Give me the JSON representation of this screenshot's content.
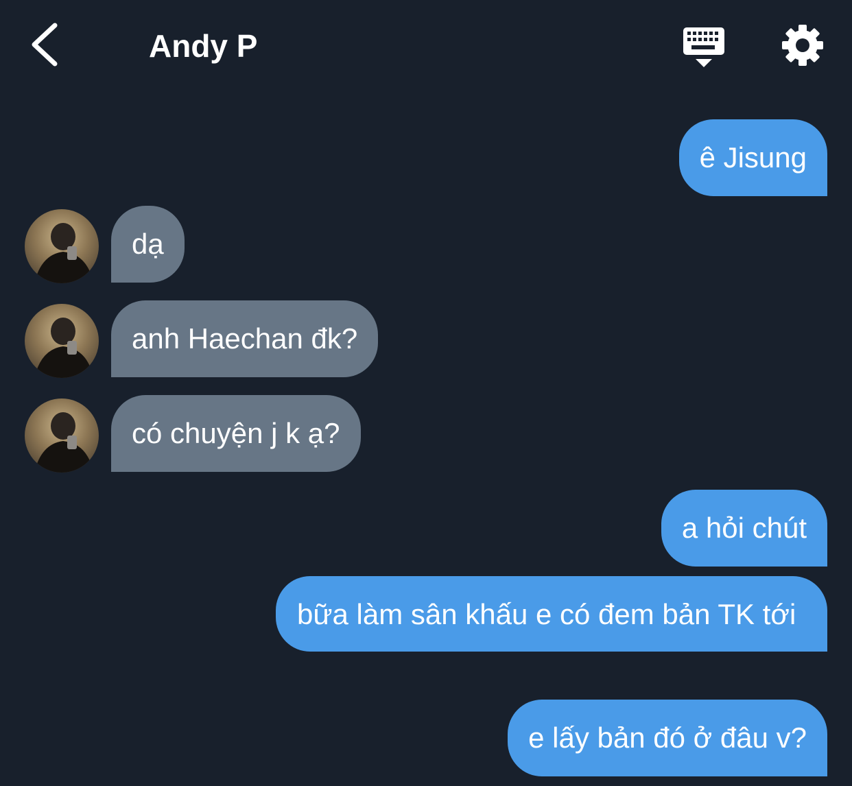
{
  "header": {
    "title": "Andy P"
  },
  "messages": [
    {
      "direction": "out",
      "text": "ê Jisung"
    },
    {
      "direction": "in",
      "text": "dạ"
    },
    {
      "direction": "in",
      "text": "anh Haechan đk?"
    },
    {
      "direction": "in",
      "text": "có chuyện j k ạ?"
    },
    {
      "direction": "out",
      "text": "a hỏi chút"
    },
    {
      "direction": "out",
      "text": "bữa làm sân khấu e có đem bản TK tới"
    },
    {
      "direction": "out",
      "text": "e lấy bản đó ở đâu v?"
    }
  ],
  "colors": {
    "background": "#18202c",
    "outgoing_bubble": "#4a9be8",
    "incoming_bubble": "#677686",
    "text": "#ffffff"
  },
  "icons": [
    "back-chevron-icon",
    "keyboard-icon",
    "gear-icon"
  ]
}
